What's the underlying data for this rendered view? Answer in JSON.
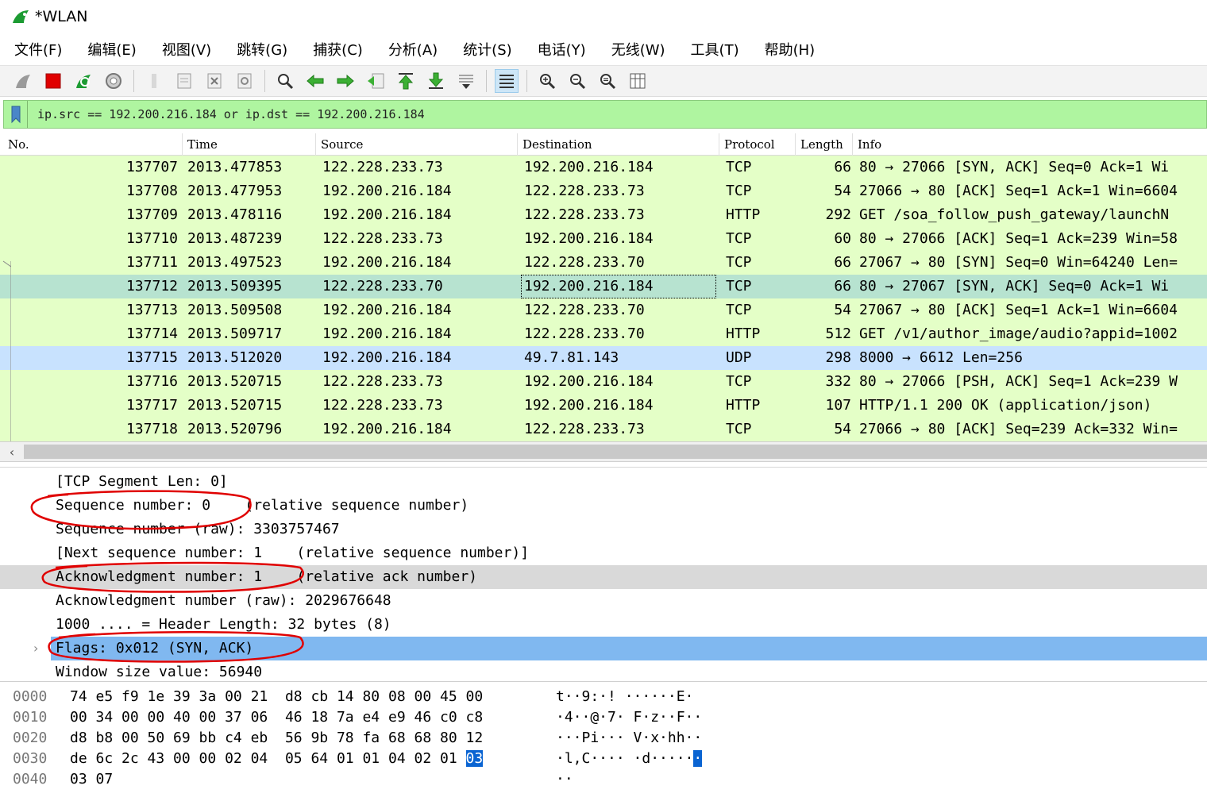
{
  "window": {
    "title": "*WLAN"
  },
  "menu": [
    "文件(F)",
    "编辑(E)",
    "视图(V)",
    "跳转(G)",
    "捕获(C)",
    "分析(A)",
    "统计(S)",
    "电话(Y)",
    "无线(W)",
    "工具(T)",
    "帮助(H)"
  ],
  "toolbar": {
    "icons": [
      "shark-fin-start-icon",
      "stop-capture-icon",
      "restart-capture-icon",
      "capture-options-icon",
      "open-file-icon",
      "save-file-icon",
      "close-file-icon",
      "reload-file-icon",
      "find-packet-icon",
      "go-back-icon",
      "go-forward-icon",
      "go-to-packet-icon",
      "go-first-icon",
      "go-last-icon",
      "auto-scroll-icon",
      "colorize-icon",
      "zoom-in-icon",
      "zoom-out-icon",
      "zoom-normal-icon",
      "resize-columns-icon"
    ]
  },
  "filter": {
    "value": "ip.src == 192.200.216.184 or ip.dst == 192.200.216.184"
  },
  "columns": {
    "no": "No.",
    "time": "Time",
    "source": "Source",
    "destination": "Destination",
    "protocol": "Protocol",
    "length": "Length",
    "info": "Info"
  },
  "packets": [
    {
      "no": "137707",
      "time": "2013.477853",
      "src": "122.228.233.73",
      "dst": "192.200.216.184",
      "proto": "TCP",
      "len": "66",
      "info": "80 → 27066 [SYN, ACK] Seq=0 Ack=1 Wi",
      "style": "tcp"
    },
    {
      "no": "137708",
      "time": "2013.477953",
      "src": "192.200.216.184",
      "dst": "122.228.233.73",
      "proto": "TCP",
      "len": "54",
      "info": "27066 → 80 [ACK] Seq=1 Ack=1 Win=6604",
      "style": "tcp"
    },
    {
      "no": "137709",
      "time": "2013.478116",
      "src": "192.200.216.184",
      "dst": "122.228.233.73",
      "proto": "HTTP",
      "len": "292",
      "info": "GET /soa_follow_push_gateway/launchN",
      "style": "tcp"
    },
    {
      "no": "137710",
      "time": "2013.487239",
      "src": "122.228.233.73",
      "dst": "192.200.216.184",
      "proto": "TCP",
      "len": "60",
      "info": "80 → 27066 [ACK] Seq=1 Ack=239 Win=58",
      "style": "tcp"
    },
    {
      "no": "137711",
      "time": "2013.497523",
      "src": "192.200.216.184",
      "dst": "122.228.233.70",
      "proto": "TCP",
      "len": "66",
      "info": "27067 → 80 [SYN] Seq=0 Win=64240 Len=",
      "style": "tcp"
    },
    {
      "no": "137712",
      "time": "2013.509395",
      "src": "122.228.233.70",
      "dst": "192.200.216.184",
      "proto": "TCP",
      "len": "66",
      "info": "80 → 27067 [SYN, ACK] Seq=0 Ack=1 Wi",
      "style": "sel"
    },
    {
      "no": "137713",
      "time": "2013.509508",
      "src": "192.200.216.184",
      "dst": "122.228.233.70",
      "proto": "TCP",
      "len": "54",
      "info": "27067 → 80 [ACK] Seq=1 Ack=1 Win=6604",
      "style": "tcp"
    },
    {
      "no": "137714",
      "time": "2013.509717",
      "src": "192.200.216.184",
      "dst": "122.228.233.70",
      "proto": "HTTP",
      "len": "512",
      "info": "GET /v1/author_image/audio?appid=1002",
      "style": "tcp"
    },
    {
      "no": "137715",
      "time": "2013.512020",
      "src": "192.200.216.184",
      "dst": "49.7.81.143",
      "proto": "UDP",
      "len": "298",
      "info": "8000 → 6612 Len=256",
      "style": "udp"
    },
    {
      "no": "137716",
      "time": "2013.520715",
      "src": "122.228.233.73",
      "dst": "192.200.216.184",
      "proto": "TCP",
      "len": "332",
      "info": "80 → 27066 [PSH, ACK] Seq=1 Ack=239 W",
      "style": "tcp"
    },
    {
      "no": "137717",
      "time": "2013.520715",
      "src": "122.228.233.73",
      "dst": "192.200.216.184",
      "proto": "HTTP",
      "len": "107",
      "info": "HTTP/1.1 200 OK  (application/json)",
      "style": "tcp"
    },
    {
      "no": "137718",
      "time": "2013.520796",
      "src": "192.200.216.184",
      "dst": "122.228.233.73",
      "proto": "TCP",
      "len": "54",
      "info": "27066 → 80 [ACK] Seq=239 Ack=332 Win=",
      "style": "tcp"
    }
  ],
  "details": {
    "seg_len": "[TCP Segment Len: 0]",
    "seq": "Sequence number: 0    (relative sequence number)",
    "seq_raw": "Sequence number (raw): 3303757467",
    "next_seq": "[Next sequence number: 1    (relative sequence number)]",
    "ack": "Acknowledgment number: 1    (relative ack number)",
    "ack_raw": "Acknowledgment number (raw): 2029676648",
    "header_len": "1000 .... = Header Length: 32 bytes (8)",
    "flags": "Flags: 0x012 (SYN, ACK)",
    "window": "Window size value: 56940"
  },
  "hex": [
    {
      "off": "0000",
      "b1": "74 e5 f9 1e 39 3a 00 21",
      "b2": "d8 cb 14 80 08 00 45 00",
      "b2hl": "",
      "ascii": "t··9:·! ······E·",
      "asciihl": ""
    },
    {
      "off": "0010",
      "b1": "00 34 00 00 40 00 37 06",
      "b2": "46 18 7a e4 e9 46 c0 c8",
      "b2hl": "",
      "ascii": "·4··@·7· F·z··F··",
      "asciihl": ""
    },
    {
      "off": "0020",
      "b1": "d8 b8 00 50 69 bb c4 eb",
      "b2": "56 9b 78 fa 68 68 80 12",
      "b2hl": "",
      "ascii": "···Pi··· V·x·hh··",
      "asciihl": ""
    },
    {
      "off": "0030",
      "b1": "de 6c 2c 43 00 00 02 04",
      "b2": "05 64 01 01 04 02 01 ",
      "b2hl": "03",
      "ascii": "·l,C···· ·d·····",
      "asciihl": "·"
    },
    {
      "off": "0040",
      "b1": "03 07",
      "b2": "",
      "b2hl": "",
      "ascii": "··",
      "asciihl": ""
    }
  ],
  "colors": {
    "tcp_row": "#e4ffc7",
    "selected_row": "#b7e3d0",
    "udp_row": "#c8e2fe",
    "filter_bg": "#aff5a0",
    "flags_highlight": "#80b8f0",
    "annotation": "#e00000"
  }
}
